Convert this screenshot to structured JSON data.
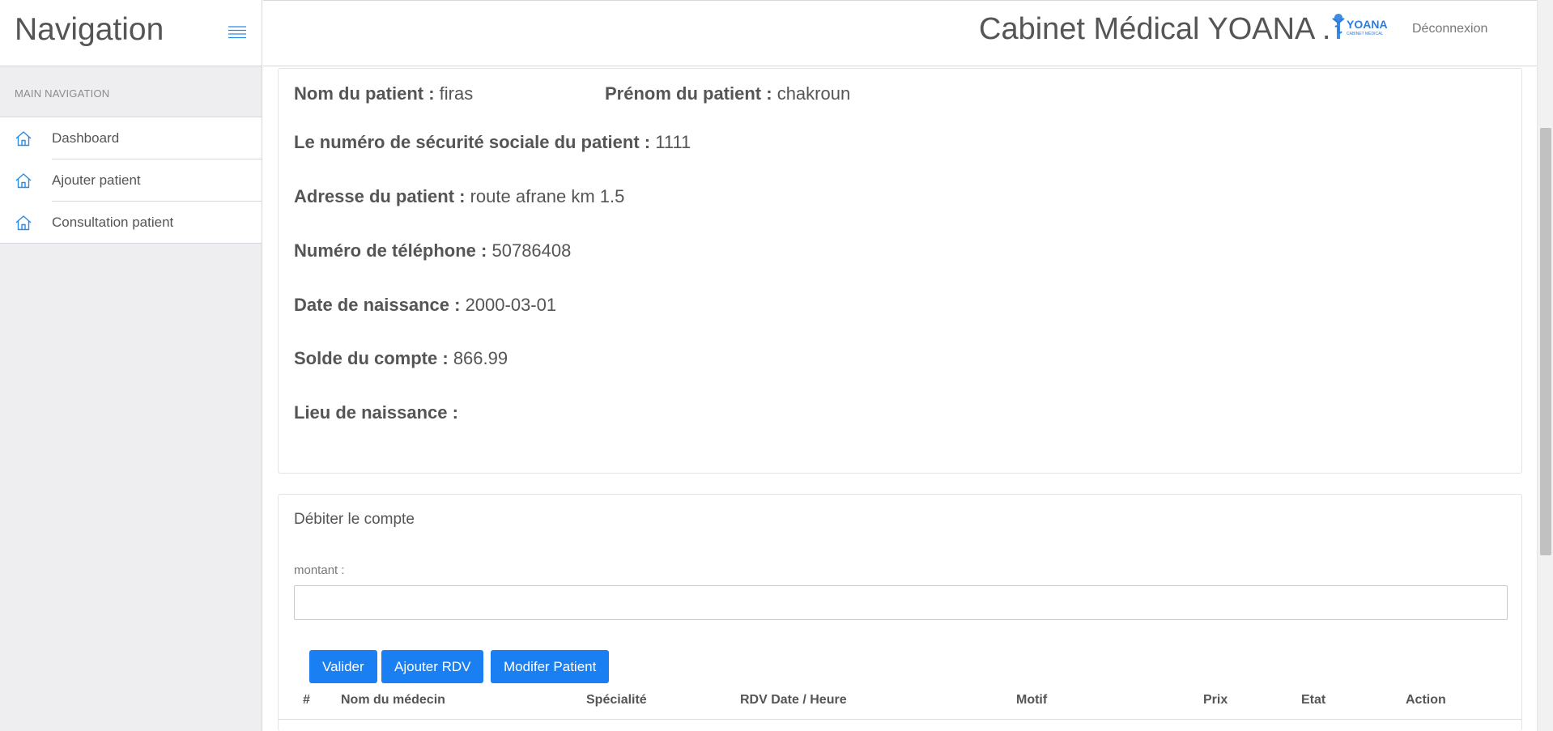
{
  "sidebar": {
    "brand": "Navigation",
    "section_header": "MAIN NAVIGATION",
    "items": [
      {
        "label": "Dashboard",
        "icon": "home-icon"
      },
      {
        "label": "Ajouter patient",
        "icon": "home-icon"
      },
      {
        "label": "Consultation patient",
        "icon": "home-icon"
      }
    ]
  },
  "header": {
    "title": "Cabinet Médical YOANA .",
    "logo_text": "YOANA",
    "logo_subtext": "CABINET MÉDICAL",
    "logout": "Déconnexion"
  },
  "patient": {
    "nom_label": "Nom du patient :",
    "nom_value": "firas",
    "prenom_label": "Prénom du patient :",
    "prenom_value": "chakroun",
    "secu_label": "Le numéro de sécurité sociale du patient :",
    "secu_value": "1111",
    "adresse_label": "Adresse du patient :",
    "adresse_value": "route afrane km 1.5",
    "tel_label": "Numéro de téléphone :",
    "tel_value": "50786408",
    "naissance_label": "Date de naissance :",
    "naissance_value": "2000-03-01",
    "solde_label": "Solde du compte :",
    "solde_value": "866.99",
    "lieu_label": "Lieu de naissance :",
    "lieu_value": ""
  },
  "debit": {
    "title": "Débiter le compte",
    "amount_label": "montant :",
    "amount_value": "",
    "buttons": {
      "valider": "Valider",
      "ajouter_rdv": "Ajouter RDV",
      "modifier": "Modifer Patient"
    },
    "table_headers": [
      "#",
      "Nom du médecin",
      "Spécialité",
      "RDV Date / Heure",
      "Motif",
      "Prix",
      "Etat",
      "Action"
    ]
  },
  "colors": {
    "accent": "#1a7ff3",
    "icon": "#2a8ae6"
  }
}
